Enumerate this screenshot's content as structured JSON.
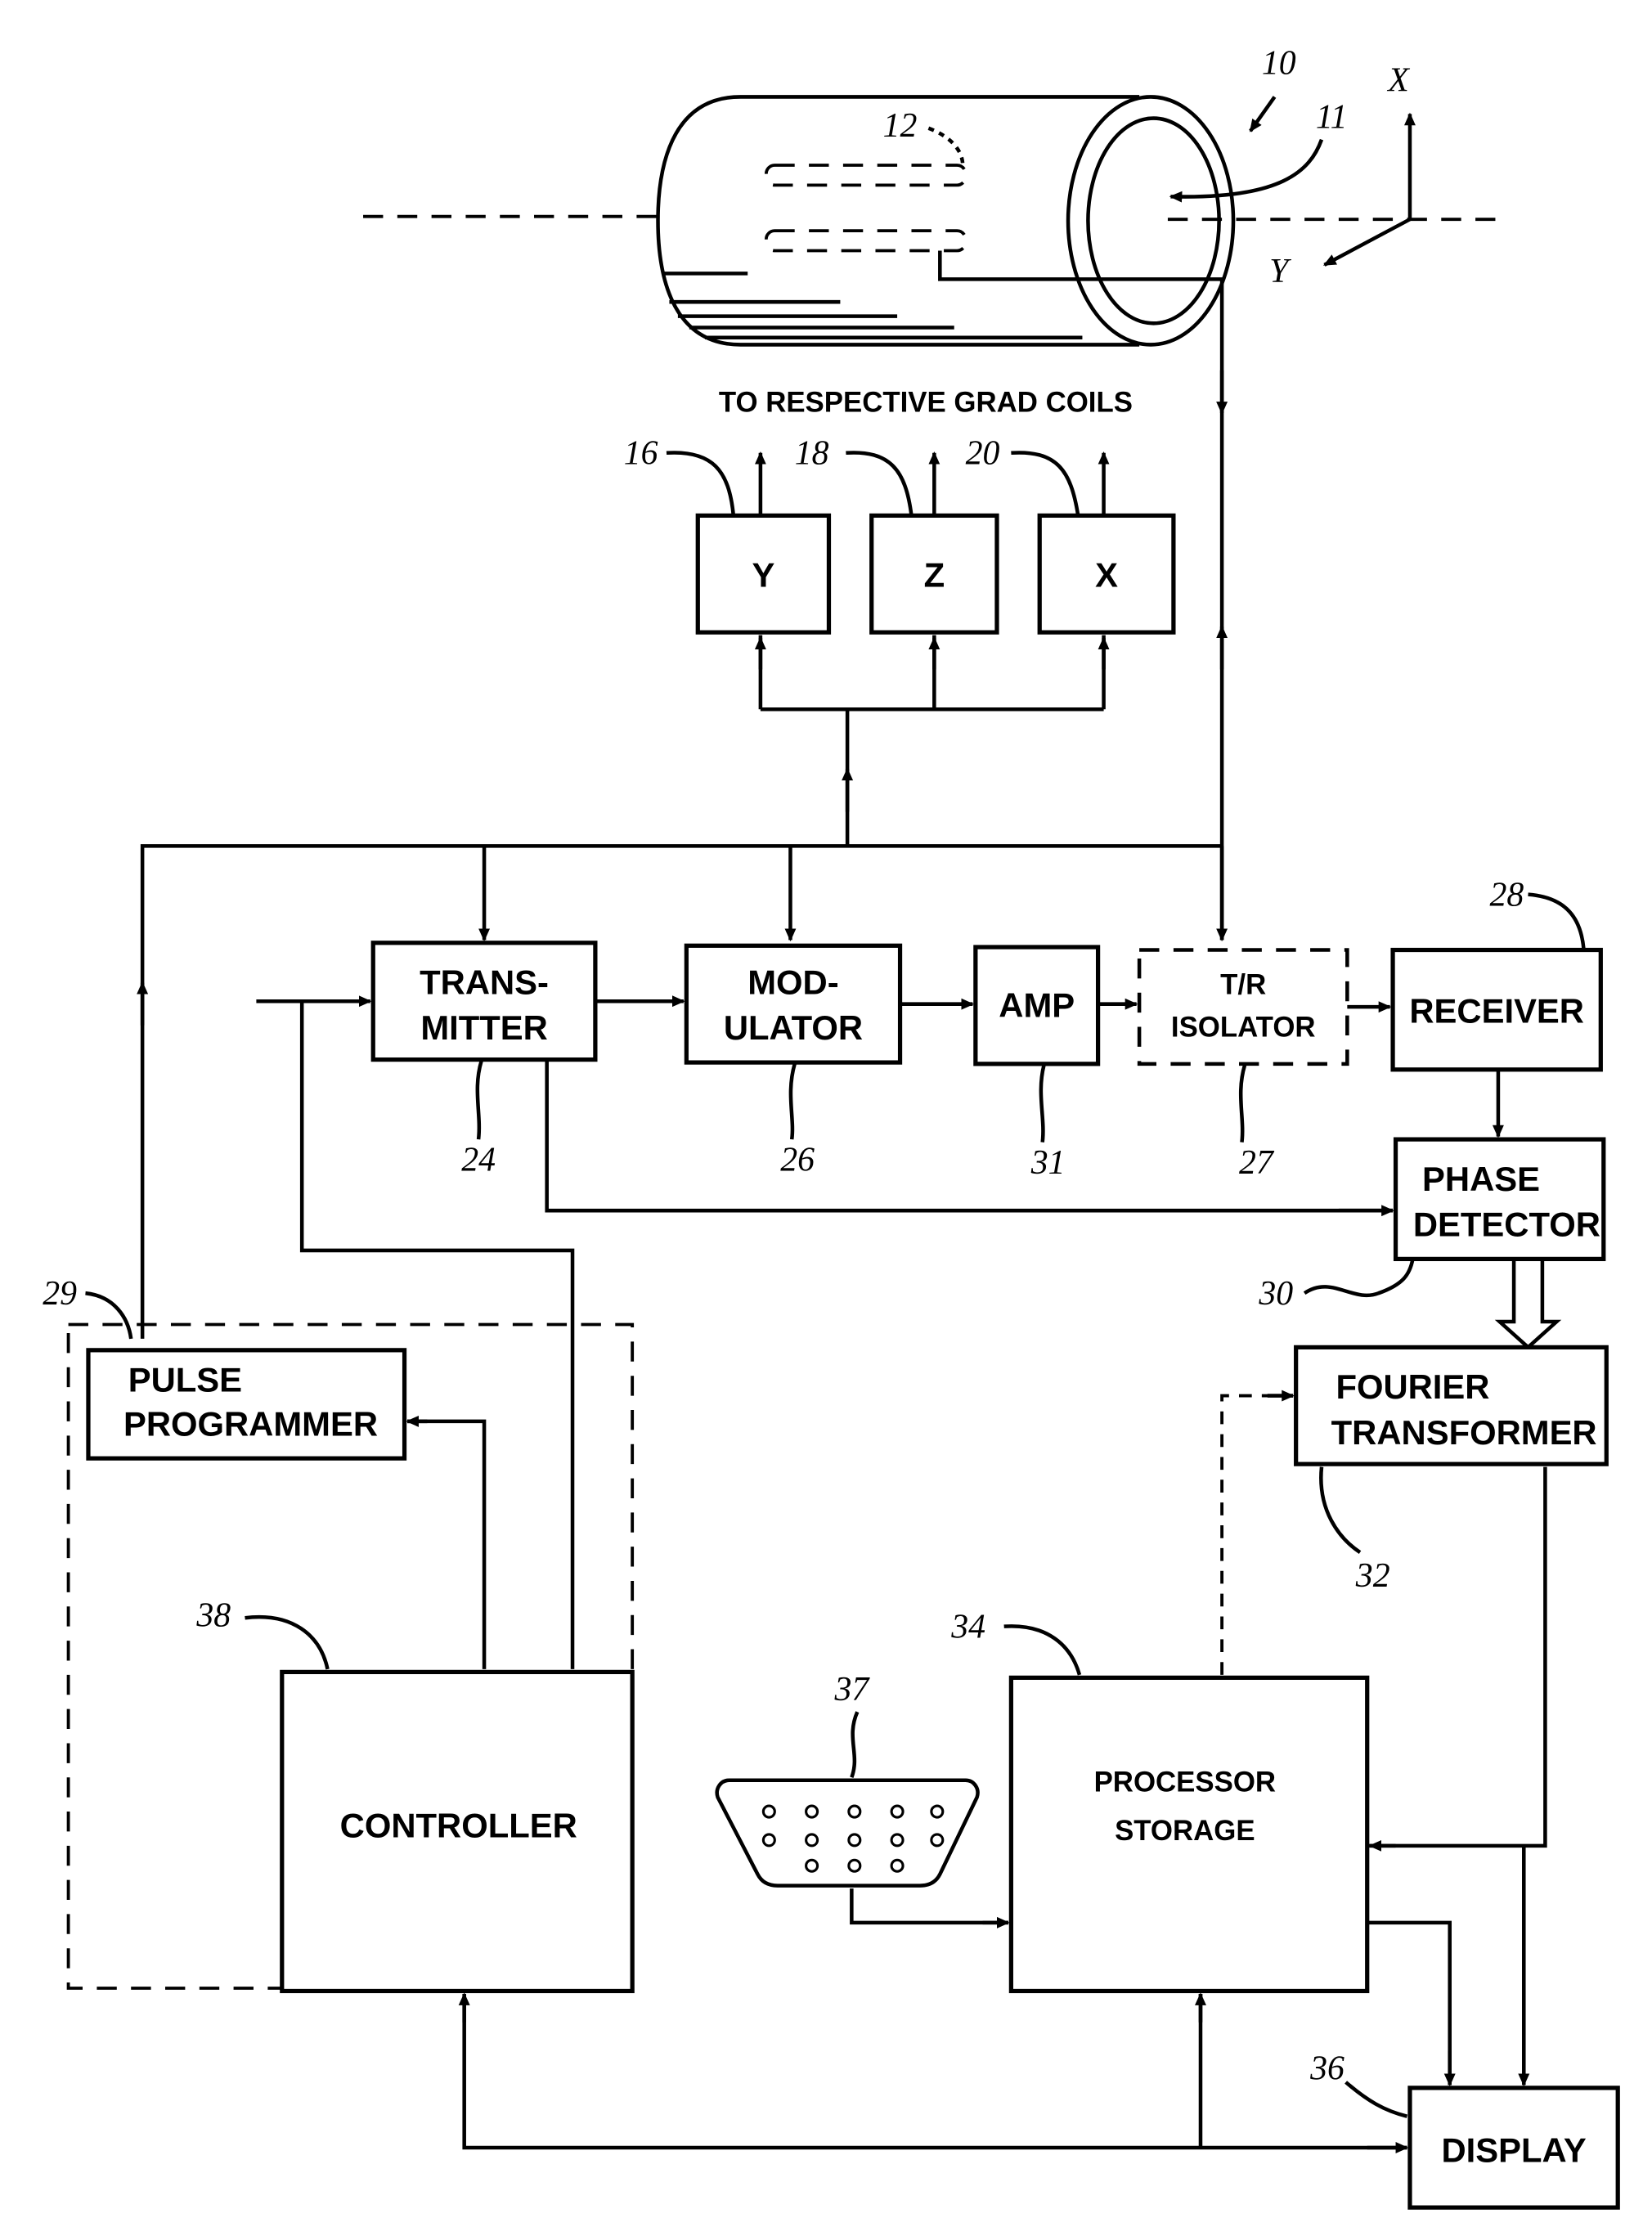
{
  "magnet": {
    "ref_system": "10",
    "ref_bore": "11",
    "ref_coils": "12",
    "axis_x": "X",
    "axis_y": "Y"
  },
  "grad_caption": "TO RESPECTIVE GRAD COILS",
  "grad_amps": [
    {
      "label": "Y",
      "ref": "16"
    },
    {
      "label": "Z",
      "ref": "18"
    },
    {
      "label": "X",
      "ref": "20"
    }
  ],
  "blocks": {
    "transmitter": {
      "line1": "TRANS-",
      "line2": "MITTER",
      "ref": "24"
    },
    "modulator": {
      "line1": "MOD-",
      "line2": "ULATOR",
      "ref": "26"
    },
    "amp": {
      "label": "AMP",
      "ref": "31"
    },
    "tr_isolator": {
      "line1": "T/R",
      "line2": "ISOLATOR",
      "ref": "27"
    },
    "receiver": {
      "label": "RECEIVER",
      "ref": "28"
    },
    "phase_detector": {
      "line1": "PHASE",
      "line2": "DETECTOR",
      "ref": "30"
    },
    "pulse_programmer": {
      "line1": "PULSE",
      "line2": "PROGRAMMER",
      "ref": "29"
    },
    "fourier": {
      "line1": "FOURIER",
      "line2": "TRANSFORMER",
      "ref": "32"
    },
    "controller": {
      "label": "CONTROLLER",
      "ref": "38"
    },
    "processor": {
      "line1": "PROCESSOR",
      "line2": "STORAGE",
      "ref": "34"
    },
    "connector": {
      "ref": "37"
    },
    "display": {
      "label": "DISPLAY",
      "ref": "36"
    }
  }
}
